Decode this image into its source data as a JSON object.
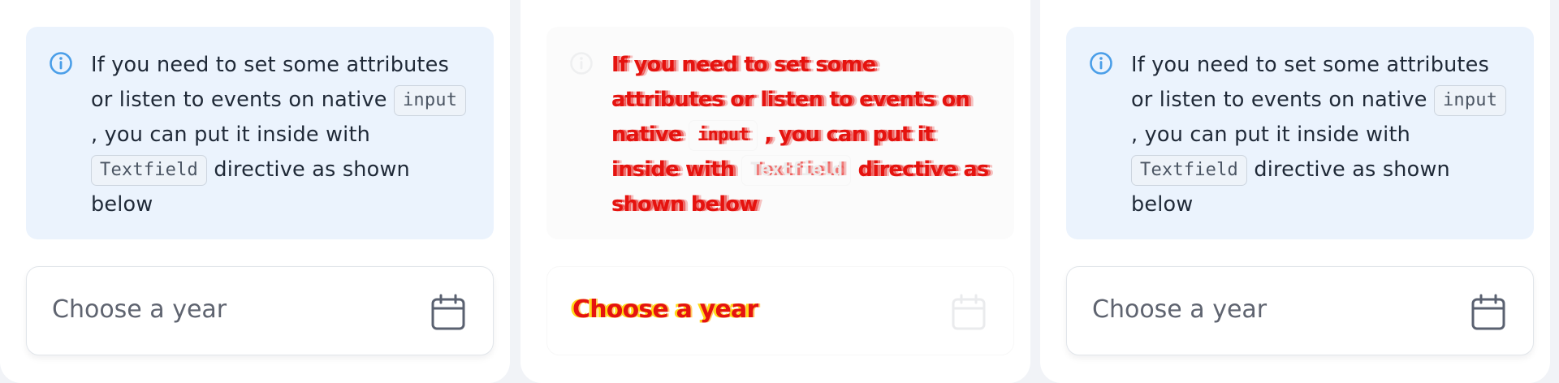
{
  "colors": {
    "info_background": "#ebf3fd",
    "info_icon": "#4a9ee8",
    "calendar_icon": "#5a6170",
    "glitch_text": "#e5130f",
    "glitch_highlight": "#ffd600"
  },
  "panels": [
    {
      "info": {
        "icon": "info-circle-icon",
        "text_before_code": "If you need to set some attributes or listen to events on native",
        "code_1": "input",
        "text_after_code_1": ", you can put it inside with",
        "code_2": "Textfield",
        "text_after_code_2": "directive as shown below"
      },
      "field": {
        "placeholder": "Choose a year",
        "icon": "calendar-icon"
      }
    },
    {
      "info": {
        "icon": "info-circle-icon",
        "text_before_code": "If you need to set some attributes or listen to events on native",
        "code_1": "input",
        "text_after_code_1": ", you can put it inside with",
        "code_2": "Textfield",
        "text_after_code_2": "directive as shown below"
      },
      "field": {
        "placeholder": "Choose a year",
        "icon": "calendar-icon"
      }
    },
    {
      "info": {
        "icon": "info-circle-icon",
        "text_before_code": "If you need to set some attributes or listen to events on native",
        "code_1": "input",
        "text_after_code_1": ", you can put it inside with",
        "code_2": "Textfield",
        "text_after_code_2": "directive as shown below"
      },
      "field": {
        "placeholder": "Choose a year",
        "icon": "calendar-icon"
      }
    }
  ]
}
